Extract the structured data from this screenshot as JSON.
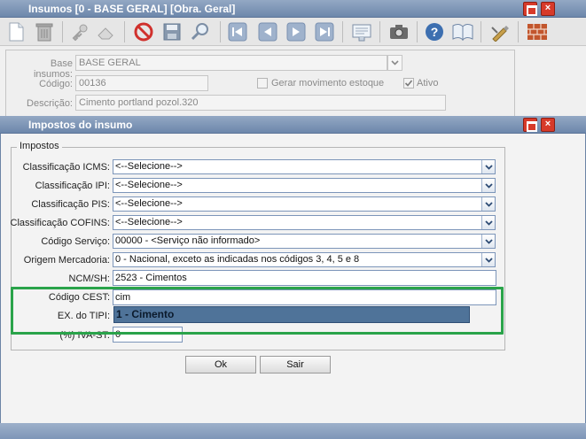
{
  "main_window": {
    "title": "Insumos [0 - BASE GERAL] [Obra. Geral]",
    "form": {
      "base_insumos_label": "Base insumos:",
      "base_insumos_value": "BASE GERAL",
      "codigo_label": "Código:",
      "codigo_value": "00136",
      "gerar_movimento_label": "Gerar movimento estoque",
      "ativo_label": "Ativo",
      "ativo_checked": true,
      "descricao_label": "Descrição:",
      "descricao_value": "Cimento portland pozol.320"
    }
  },
  "toolbar": {
    "icons": [
      "new-document-icon",
      "trash-icon",
      "key-icon",
      "eraser-icon",
      "cancel-icon",
      "save-icon",
      "search-icon",
      "first-record-icon",
      "previous-record-icon",
      "next-record-icon",
      "last-record-icon",
      "report-icon",
      "camera-icon",
      "help-icon",
      "book-icon",
      "edit-tools-icon",
      "bricks-icon"
    ]
  },
  "dialog": {
    "title": "Impostos do insumo",
    "group_label": "Impostos",
    "fields": {
      "icms_label": "Classificação ICMS:",
      "icms_value": "<--Selecione-->",
      "ipi_label": "Classificação IPI:",
      "ipi_value": "<--Selecione-->",
      "pis_label": "Classificação PIS:",
      "pis_value": "<--Selecione-->",
      "cofins_label": "Classificação COFINS:",
      "cofins_value": "<--Selecione-->",
      "servico_label": "Código Serviço:",
      "servico_value": "00000 - <Serviço não informado>",
      "origem_label": "Origem Mercadoria:",
      "origem_value": "0 - Nacional, exceto as indicadas nos códigos 3, 4, 5 e 8",
      "ncm_label": "NCM/SH:",
      "ncm_value": "2523 - Cimentos",
      "cest_label": "Código CEST:",
      "cest_value": "cim",
      "tipi_label": "EX. do TIPI:",
      "tipi_suggestion": "1 - Cimento",
      "iva_label": "(%) IVA-ST:",
      "iva_value": "0"
    },
    "ok_label": "Ok",
    "sair_label": "Sair"
  },
  "colors": {
    "title_bar": "#7d95b8",
    "close_button": "#d73a2a",
    "highlight_border": "#2aa34a",
    "suggestion_bg": "#4f7399"
  }
}
